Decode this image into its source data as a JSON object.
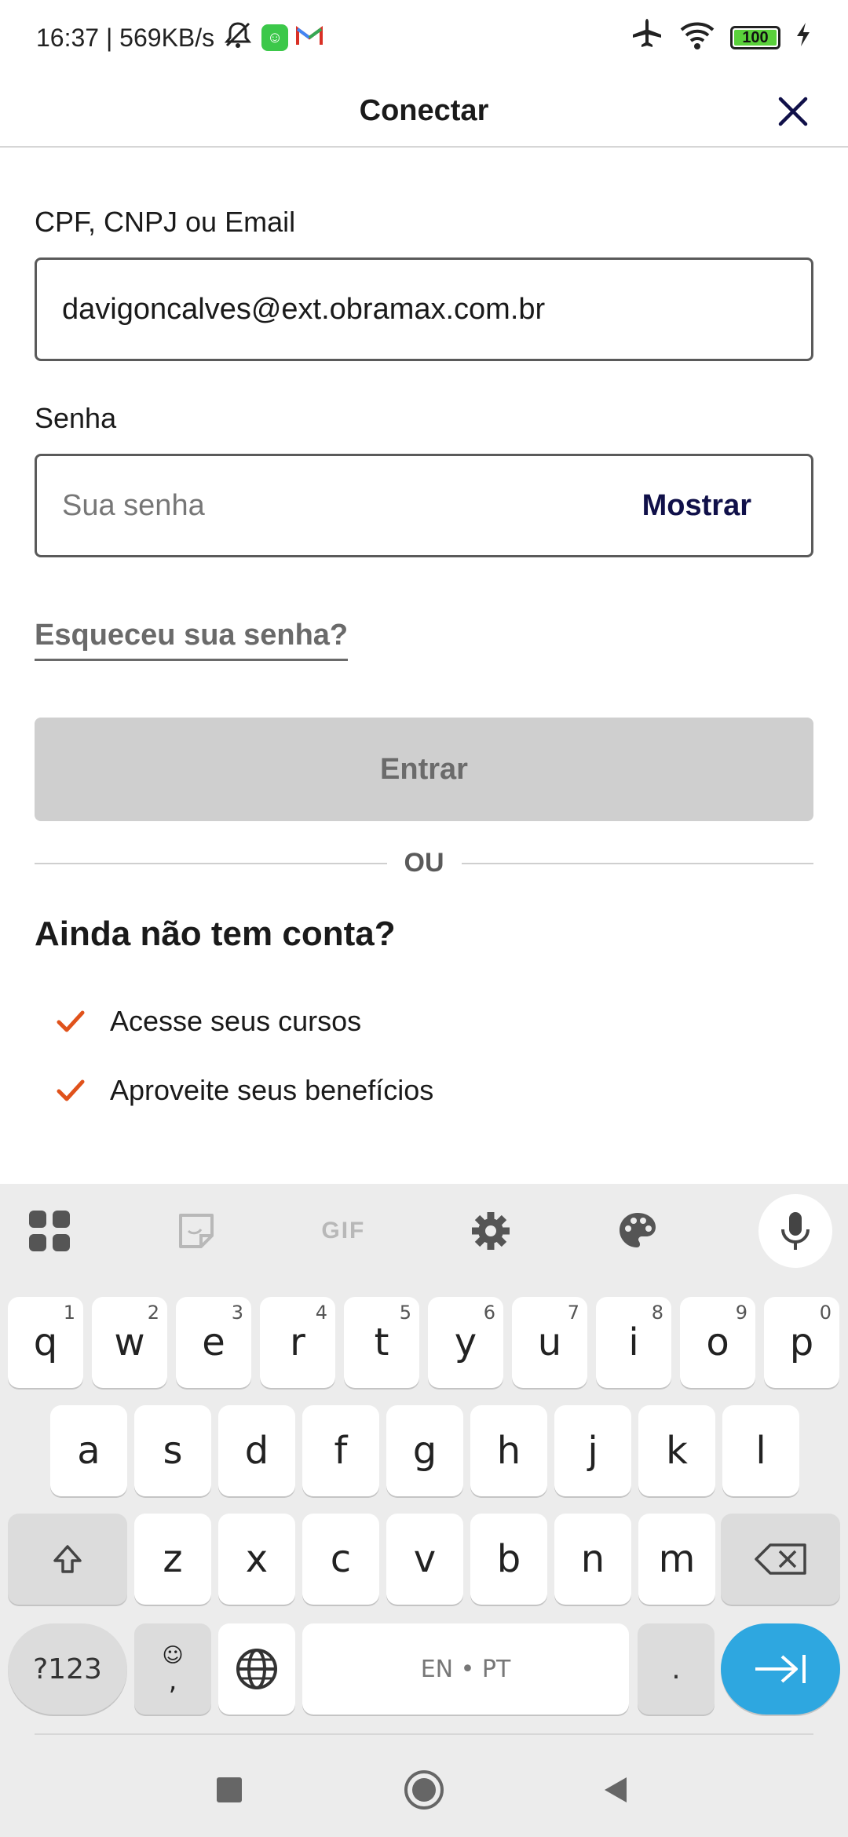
{
  "status_bar": {
    "time_speed": "16:37 | 569KB/s",
    "battery": "100"
  },
  "header": {
    "title": "Conectar"
  },
  "form": {
    "login_label": "CPF, CNPJ ou Email",
    "login_value": "davigoncalves@ext.obramax.com.br",
    "password_label": "Senha",
    "password_placeholder": "Sua senha",
    "show_label": "Mostrar",
    "forgot_label": "Esqueceu sua senha?",
    "submit_label": "Entrar",
    "divider_label": "OU"
  },
  "signup": {
    "title": "Ainda não tem conta?",
    "benefits": [
      "Acesse seus cursos",
      "Aproveite seus benefícios"
    ],
    "accent_color": "#e0521b"
  },
  "keyboard": {
    "toolbar_gif": "GIF",
    "row1": [
      {
        "key": "q",
        "hint": "1"
      },
      {
        "key": "w",
        "hint": "2"
      },
      {
        "key": "e",
        "hint": "3"
      },
      {
        "key": "r",
        "hint": "4"
      },
      {
        "key": "t",
        "hint": "5"
      },
      {
        "key": "y",
        "hint": "6"
      },
      {
        "key": "u",
        "hint": "7"
      },
      {
        "key": "i",
        "hint": "8"
      },
      {
        "key": "o",
        "hint": "9"
      },
      {
        "key": "p",
        "hint": "0"
      }
    ],
    "row2": [
      "a",
      "s",
      "d",
      "f",
      "g",
      "h",
      "j",
      "k",
      "l"
    ],
    "row3": [
      "z",
      "x",
      "c",
      "v",
      "b",
      "n",
      "m"
    ],
    "symbols_label": "?123",
    "comma_label": ",",
    "space_label": "EN • PT",
    "period_label": ".",
    "enter_color": "#2ea7e0"
  }
}
